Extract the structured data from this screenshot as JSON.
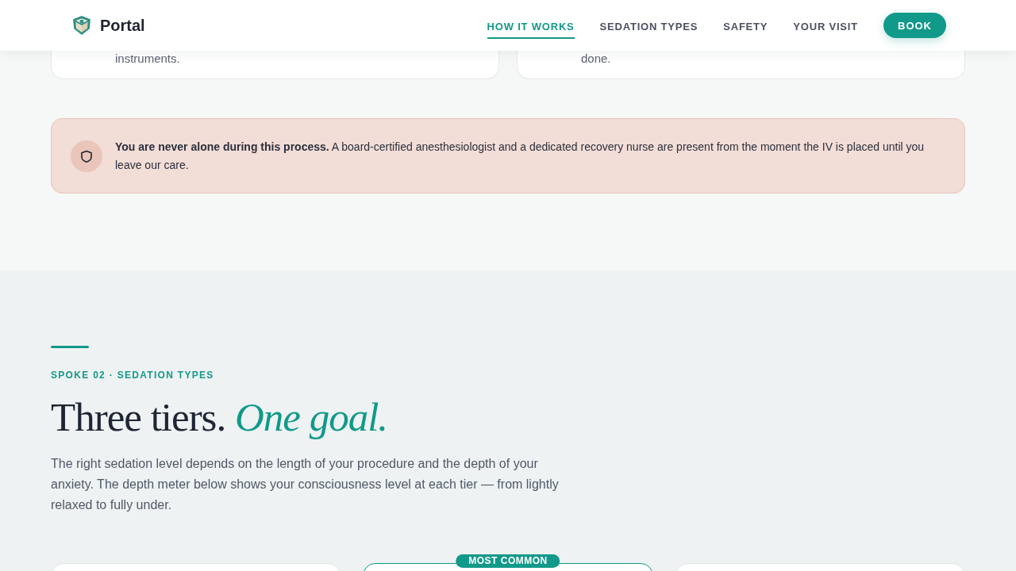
{
  "header": {
    "logo": "Portal",
    "nav": [
      {
        "label": "HOW IT WORKS",
        "selected": true
      },
      {
        "label": "SEDATION TYPES",
        "selected": false
      },
      {
        "label": "SAFETY",
        "selected": false
      },
      {
        "label": "YOUR VISIT",
        "selected": false
      }
    ],
    "cta": "BOOK"
  },
  "top_cards": [
    {
      "text": "instruments."
    },
    {
      "text": "done."
    }
  ],
  "notice": {
    "text": "**You are never alone during this process.** A board-certified anesthesiologist and a dedicated recovery nurse are present from the moment the IV is placed until you leave our care."
  },
  "section": {
    "eyebrow": "SPOKE 02 · SEDATION TYPES",
    "title": "Three tiers. *One goal.*",
    "intro": "The right sedation level depends on the length of your procedure and the depth of your anxiety. The depth meter below shows your consciousness level at each tier — from lightly relaxed to fully under."
  },
  "tiers": [
    {
      "featured": false
    },
    {
      "featured": true,
      "badge": "MOST COMMON"
    },
    {
      "featured": false
    }
  ]
}
